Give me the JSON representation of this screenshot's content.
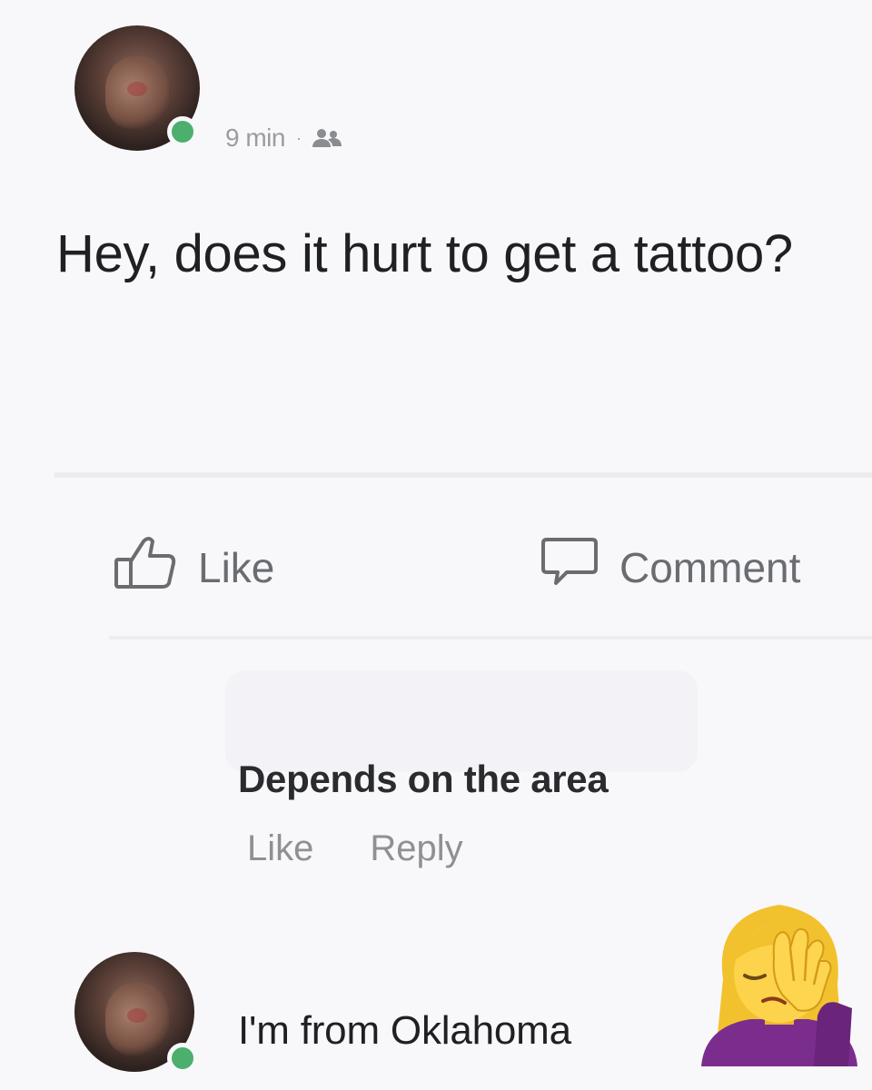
{
  "post": {
    "time": "9 min",
    "separator": "·",
    "audience_icon": "friends-icon",
    "text": "Hey, does it hurt to get a tattoo?"
  },
  "actions": {
    "like_label": "Like",
    "like_icon": "thumbs-up-icon",
    "comment_label": "Comment",
    "comment_icon": "speech-bubble-icon"
  },
  "reply": {
    "text": "Depends on the area",
    "like_label": "Like",
    "reply_label": "Reply"
  },
  "second_comment": {
    "text": "I'm from Oklahoma",
    "emoji": "woman-facepalming-icon"
  },
  "colors": {
    "online": "#4caf6e",
    "meta_gray": "#9a9ca1",
    "text": "#1f2023"
  }
}
